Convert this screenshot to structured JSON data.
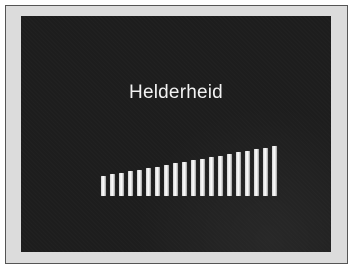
{
  "screen": {
    "title": "Helderheid"
  },
  "brightness_meter": {
    "segments_total": 20,
    "segments_lit": 20,
    "level": 1.0,
    "bar_color": "#eeeeee",
    "background_color": "#1d1d1d"
  }
}
